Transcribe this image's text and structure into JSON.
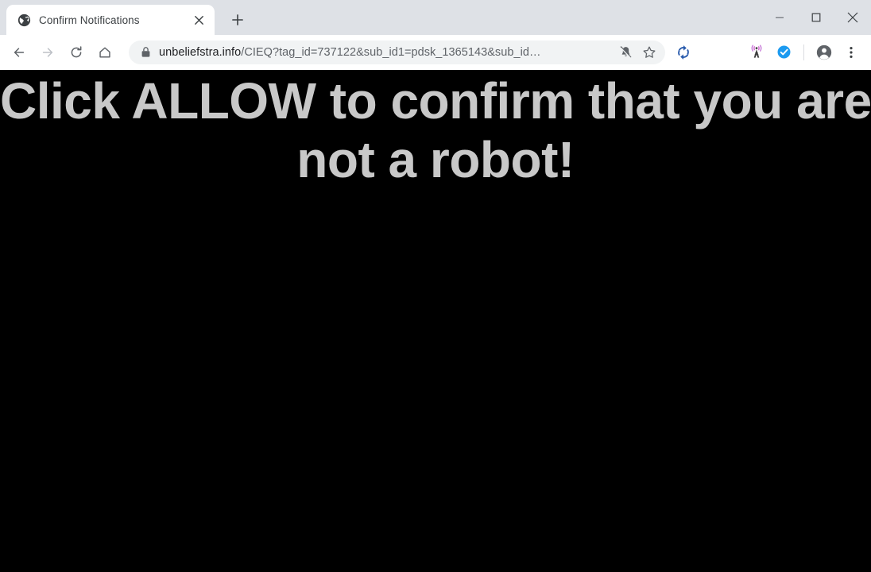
{
  "window": {
    "controls": [
      {
        "name": "minimize",
        "glyph": "minimize-icon"
      },
      {
        "name": "maximize",
        "glyph": "maximize-icon"
      },
      {
        "name": "close",
        "glyph": "close-icon"
      }
    ]
  },
  "tabstrip": {
    "tabs": [
      {
        "title": "Confirm Notifications",
        "favicon": "globe-icon",
        "close_label": "×",
        "active": true
      }
    ],
    "new_tab_label": "+"
  },
  "toolbar": {
    "back_label": "back-arrow-icon",
    "forward_label": "forward-arrow-icon",
    "reload_label": "reload-icon",
    "home_label": "home-icon",
    "omnibox": {
      "security_icon": "lock-icon",
      "host": "unbeliefstra.info",
      "path": "/CIEQ?tag_id=737122&sub_id1=pdsk_1365143&sub_id…",
      "placeholder": "Search Google or type a URL",
      "notifications_blocked_icon": "bell-slash-icon",
      "bookmark_icon": "star-icon"
    },
    "extensions": [
      {
        "name": "sync-extension",
        "icon": "sync-refresh-icon",
        "color": "#2b5cad"
      },
      {
        "name": "broadcast-extension",
        "icon": "radio-tower-icon",
        "color": "#d36ad3"
      },
      {
        "name": "verified-extension",
        "icon": "check-circle-icon",
        "color": "#1b9af0"
      }
    ],
    "profile_icon": "account-avatar-icon",
    "menu_icon": "three-dot-menu-icon"
  },
  "page": {
    "background_color": "#000000",
    "text_color": "#c8c8c8",
    "headline_line1": "Click ALLOW to confirm that you are",
    "headline_line2": "not a robot!"
  }
}
